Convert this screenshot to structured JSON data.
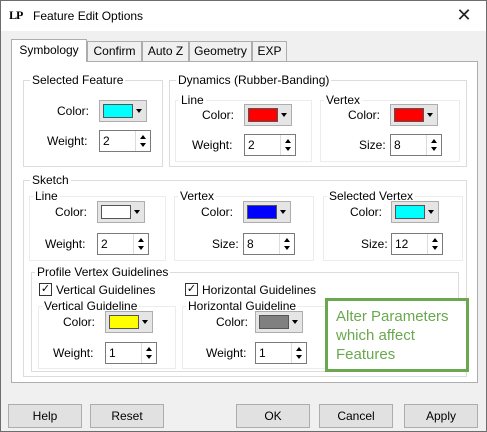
{
  "window": {
    "app_icon": "LP",
    "title": "Feature Edit Options",
    "close_glyph": "✕"
  },
  "tabs": [
    {
      "label": "Symbology"
    },
    {
      "label": "Confirm"
    },
    {
      "label": "Auto Z"
    },
    {
      "label": "Geometry"
    },
    {
      "label": "EXP"
    }
  ],
  "selected_feature": {
    "group": "Selected Feature",
    "color_label": "Color:",
    "color": "#00ffff",
    "weight_label": "Weight:",
    "weight": "2"
  },
  "dynamics": {
    "group": "Dynamics (Rubber-Banding)",
    "line": {
      "group": "Line",
      "color_label": "Color:",
      "color": "#ff0000",
      "weight_label": "Weight:",
      "weight": "2"
    },
    "vertex": {
      "group": "Vertex",
      "color_label": "Color:",
      "color": "#ff0000",
      "size_label": "Size:",
      "size": "8"
    }
  },
  "sketch": {
    "group": "Sketch",
    "line": {
      "group": "Line",
      "color_label": "Color:",
      "color": "#ffffff",
      "weight_label": "Weight:",
      "weight": "2"
    },
    "vertex": {
      "group": "Vertex",
      "color_label": "Color:",
      "color": "#0000ff",
      "size_label": "Size:",
      "size": "8"
    },
    "selected_vertex": {
      "group": "Selected Vertex",
      "color_label": "Color:",
      "color": "#00ffff",
      "size_label": "Size:",
      "size": "12"
    }
  },
  "guidelines": {
    "group": "Profile Vertex Guidelines",
    "vertical_check": {
      "label": "Vertical Guidelines",
      "checked": true,
      "mark": "✓"
    },
    "horizontal_check": {
      "label": "Horizontal Guidelines",
      "checked": true,
      "mark": "✓"
    },
    "vertical": {
      "group": "Vertical Guideline",
      "color_label": "Color:",
      "color": "#ffff00",
      "weight_label": "Weight:",
      "weight": "1"
    },
    "horizontal": {
      "group": "Horizontal Guideline",
      "color_label": "Color:",
      "color": "#808080",
      "weight_label": "Weight:",
      "weight": "1"
    }
  },
  "callout": {
    "text": "Alter Parameters which affect Features"
  },
  "buttons": {
    "help": "Help",
    "reset": "Reset",
    "ok": "OK",
    "cancel": "Cancel",
    "apply": "Apply"
  }
}
